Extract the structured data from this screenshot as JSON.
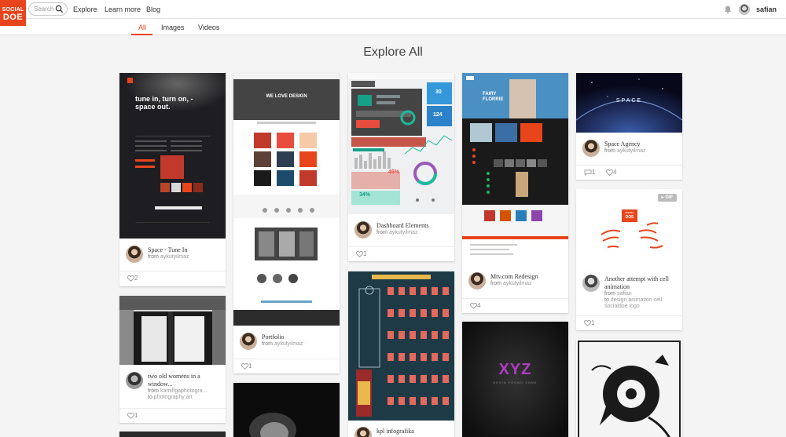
{
  "brand": {
    "line1": "SOCIAL",
    "line2": "DOE",
    "color": "#e8451d"
  },
  "search": {
    "placeholder": "Search"
  },
  "nav": {
    "explore": "Explore",
    "learn_more": "Learn more",
    "blog": "Blog"
  },
  "user": {
    "name": "safian"
  },
  "tabs": {
    "all": "All",
    "images": "Images",
    "videos": "Videos"
  },
  "page_title": "Explore All",
  "cards": {
    "space_tune_in": {
      "title": "Space - Tune In",
      "from_label": "from",
      "author": "aykutyilmaz",
      "likes": "2",
      "thumb_text_1": "tune in, turn on, -",
      "thumb_text_2": "space out."
    },
    "two_old_womens": {
      "title": "two old womens in a window...",
      "from_label": "from",
      "author": "kamilfgaphotogra...",
      "to_label": "to",
      "to_target": "photography art",
      "likes": "1"
    },
    "portfolio": {
      "title": "Portfolio",
      "from_label": "from",
      "author": "aykutyilmaz",
      "likes": "1",
      "thumb_text": "WE LOVE DESIGN"
    },
    "dashboard": {
      "title": "Dashboard Elements",
      "from_label": "from",
      "author": "aykutyilmaz",
      "likes": "1",
      "thumb_pct_1": "46%",
      "thumb_pct_2": "34%",
      "thumb_num_1": "30",
      "thumb_num_2": "124"
    },
    "kpl": {
      "title": "kpl infografika"
    },
    "mtv": {
      "title": "Mtv.com Redesign",
      "from_label": "from",
      "author": "aykutyilmaz",
      "likes": "4",
      "thumb_text": "FAIRY FLORRIE"
    },
    "xyz": {
      "thumb_text": "XYZ",
      "thumb_sub": "KEVIN YOUNG ZONE"
    },
    "space_agency": {
      "title": "Space Agency",
      "from_label": "from",
      "author": "aykutyilmaz",
      "comments": "1",
      "likes": "4",
      "thumb_text": "SPACE"
    },
    "cell_animation": {
      "title": "Another attempt with cell animation",
      "from_label": "from",
      "author": "safian",
      "to_label": "to",
      "to_target": "design animation cell socialdoe logo",
      "likes": "1",
      "badge": "GIF",
      "logo_line1": "SOCIAL",
      "logo_line2": "DOE"
    }
  }
}
